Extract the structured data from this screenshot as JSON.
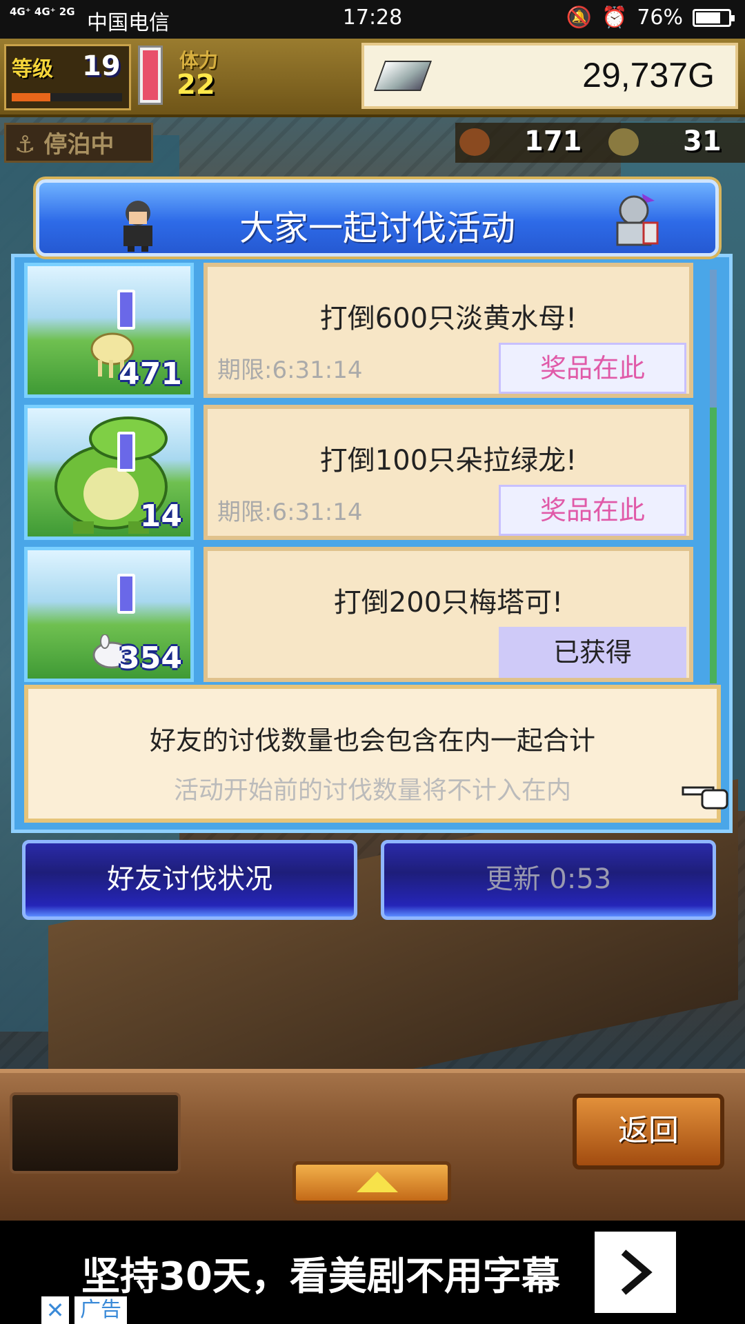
{
  "status_bar": {
    "signal": "4G⁺ 4G⁺ 2G",
    "carrier": "中国电信",
    "time": "17:28",
    "battery": "76%",
    "battery_level": 0.76
  },
  "hud": {
    "level_label": "等级",
    "level": "19",
    "stamina_label": "体力",
    "stamina": "22",
    "gold": "29,737G",
    "anchor_status": "停泊中",
    "resource_1": "171",
    "resource_2": "31"
  },
  "panel": {
    "title": "大家一起讨伐活动",
    "quests": [
      {
        "name": "打倒600只淡黄水母!",
        "deadline": "期限:6:31:14",
        "count": "471",
        "button": "奖品在此",
        "state": "prize"
      },
      {
        "name": "打倒100只朵拉绿龙!",
        "deadline": "期限:6:31:14",
        "count": "14",
        "button": "奖品在此",
        "state": "prize"
      },
      {
        "name": "打倒200只梅塔可!",
        "deadline": "",
        "count": "354",
        "button": "已获得",
        "state": "obtained"
      }
    ],
    "notice_main": "好友的讨伐数量也会包含在内一起合计",
    "notice_sub": "活动开始前的讨伐数量将不计入在内"
  },
  "buttons": {
    "friends": "好友讨伐状况",
    "refresh": "更新 0:53",
    "back": "返回"
  },
  "ad": {
    "text": "坚持30天，看美剧不用字幕",
    "close": "✕",
    "label": "广告"
  }
}
